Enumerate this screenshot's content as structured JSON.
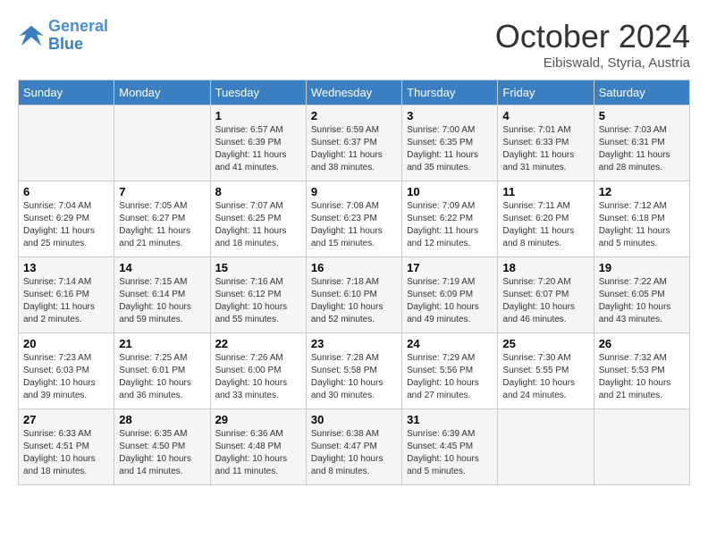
{
  "logo": {
    "line1": "General",
    "line2": "Blue"
  },
  "title": "October 2024",
  "subtitle": "Eibiswald, Styria, Austria",
  "days_of_week": [
    "Sunday",
    "Monday",
    "Tuesday",
    "Wednesday",
    "Thursday",
    "Friday",
    "Saturday"
  ],
  "weeks": [
    [
      {
        "day": "",
        "info": ""
      },
      {
        "day": "",
        "info": ""
      },
      {
        "day": "1",
        "info": "Sunrise: 6:57 AM\nSunset: 6:39 PM\nDaylight: 11 hours and 41 minutes."
      },
      {
        "day": "2",
        "info": "Sunrise: 6:59 AM\nSunset: 6:37 PM\nDaylight: 11 hours and 38 minutes."
      },
      {
        "day": "3",
        "info": "Sunrise: 7:00 AM\nSunset: 6:35 PM\nDaylight: 11 hours and 35 minutes."
      },
      {
        "day": "4",
        "info": "Sunrise: 7:01 AM\nSunset: 6:33 PM\nDaylight: 11 hours and 31 minutes."
      },
      {
        "day": "5",
        "info": "Sunrise: 7:03 AM\nSunset: 6:31 PM\nDaylight: 11 hours and 28 minutes."
      }
    ],
    [
      {
        "day": "6",
        "info": "Sunrise: 7:04 AM\nSunset: 6:29 PM\nDaylight: 11 hours and 25 minutes."
      },
      {
        "day": "7",
        "info": "Sunrise: 7:05 AM\nSunset: 6:27 PM\nDaylight: 11 hours and 21 minutes."
      },
      {
        "day": "8",
        "info": "Sunrise: 7:07 AM\nSunset: 6:25 PM\nDaylight: 11 hours and 18 minutes."
      },
      {
        "day": "9",
        "info": "Sunrise: 7:08 AM\nSunset: 6:23 PM\nDaylight: 11 hours and 15 minutes."
      },
      {
        "day": "10",
        "info": "Sunrise: 7:09 AM\nSunset: 6:22 PM\nDaylight: 11 hours and 12 minutes."
      },
      {
        "day": "11",
        "info": "Sunrise: 7:11 AM\nSunset: 6:20 PM\nDaylight: 11 hours and 8 minutes."
      },
      {
        "day": "12",
        "info": "Sunrise: 7:12 AM\nSunset: 6:18 PM\nDaylight: 11 hours and 5 minutes."
      }
    ],
    [
      {
        "day": "13",
        "info": "Sunrise: 7:14 AM\nSunset: 6:16 PM\nDaylight: 11 hours and 2 minutes."
      },
      {
        "day": "14",
        "info": "Sunrise: 7:15 AM\nSunset: 6:14 PM\nDaylight: 10 hours and 59 minutes."
      },
      {
        "day": "15",
        "info": "Sunrise: 7:16 AM\nSunset: 6:12 PM\nDaylight: 10 hours and 55 minutes."
      },
      {
        "day": "16",
        "info": "Sunrise: 7:18 AM\nSunset: 6:10 PM\nDaylight: 10 hours and 52 minutes."
      },
      {
        "day": "17",
        "info": "Sunrise: 7:19 AM\nSunset: 6:09 PM\nDaylight: 10 hours and 49 minutes."
      },
      {
        "day": "18",
        "info": "Sunrise: 7:20 AM\nSunset: 6:07 PM\nDaylight: 10 hours and 46 minutes."
      },
      {
        "day": "19",
        "info": "Sunrise: 7:22 AM\nSunset: 6:05 PM\nDaylight: 10 hours and 43 minutes."
      }
    ],
    [
      {
        "day": "20",
        "info": "Sunrise: 7:23 AM\nSunset: 6:03 PM\nDaylight: 10 hours and 39 minutes."
      },
      {
        "day": "21",
        "info": "Sunrise: 7:25 AM\nSunset: 6:01 PM\nDaylight: 10 hours and 36 minutes."
      },
      {
        "day": "22",
        "info": "Sunrise: 7:26 AM\nSunset: 6:00 PM\nDaylight: 10 hours and 33 minutes."
      },
      {
        "day": "23",
        "info": "Sunrise: 7:28 AM\nSunset: 5:58 PM\nDaylight: 10 hours and 30 minutes."
      },
      {
        "day": "24",
        "info": "Sunrise: 7:29 AM\nSunset: 5:56 PM\nDaylight: 10 hours and 27 minutes."
      },
      {
        "day": "25",
        "info": "Sunrise: 7:30 AM\nSunset: 5:55 PM\nDaylight: 10 hours and 24 minutes."
      },
      {
        "day": "26",
        "info": "Sunrise: 7:32 AM\nSunset: 5:53 PM\nDaylight: 10 hours and 21 minutes."
      }
    ],
    [
      {
        "day": "27",
        "info": "Sunrise: 6:33 AM\nSunset: 4:51 PM\nDaylight: 10 hours and 18 minutes."
      },
      {
        "day": "28",
        "info": "Sunrise: 6:35 AM\nSunset: 4:50 PM\nDaylight: 10 hours and 14 minutes."
      },
      {
        "day": "29",
        "info": "Sunrise: 6:36 AM\nSunset: 4:48 PM\nDaylight: 10 hours and 11 minutes."
      },
      {
        "day": "30",
        "info": "Sunrise: 6:38 AM\nSunset: 4:47 PM\nDaylight: 10 hours and 8 minutes."
      },
      {
        "day": "31",
        "info": "Sunrise: 6:39 AM\nSunset: 4:45 PM\nDaylight: 10 hours and 5 minutes."
      },
      {
        "day": "",
        "info": ""
      },
      {
        "day": "",
        "info": ""
      }
    ]
  ]
}
